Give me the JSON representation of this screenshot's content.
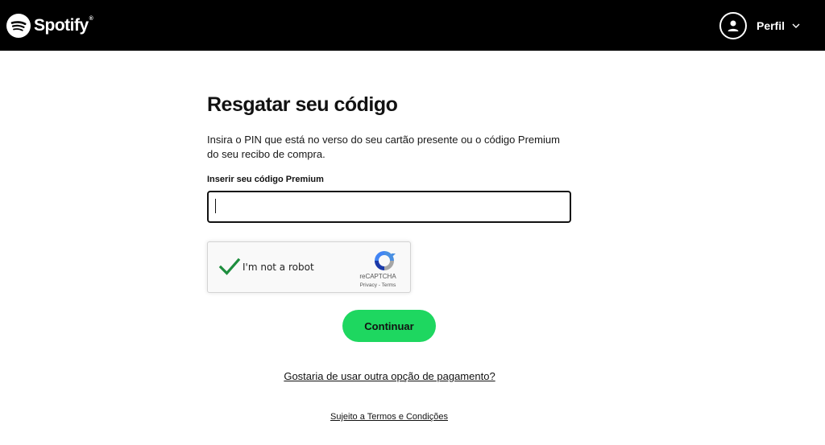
{
  "header": {
    "brand_name": "Spotify",
    "brand_mark": "®",
    "brand_icon": "spotify-logo-icon",
    "profile_label": "Perfil",
    "profile_icon": "user-icon",
    "dropdown_icon": "chevron-down-icon"
  },
  "main": {
    "title": "Resgatar seu código",
    "description": "Insira o PIN que está no verso do seu cartão presente ou o código Premium do seu recibo de compra.",
    "field_label": "Inserir seu código Premium",
    "code_value": "",
    "continue_label": "Continuar",
    "other_payment_link": "Gostaria de usar outra opção de pagamento?",
    "terms_link": "Sujeito a Termos e Condições"
  },
  "recaptcha": {
    "label": "I'm not a robot",
    "brand": "reCAPTCHA",
    "privacy": "Privacy",
    "separator": " - ",
    "terms": "Terms",
    "checked": true
  },
  "colors": {
    "header_bg": "#000000",
    "accent_green": "#1ed760",
    "check_green": "#1e8e3e",
    "text": "#121212"
  }
}
